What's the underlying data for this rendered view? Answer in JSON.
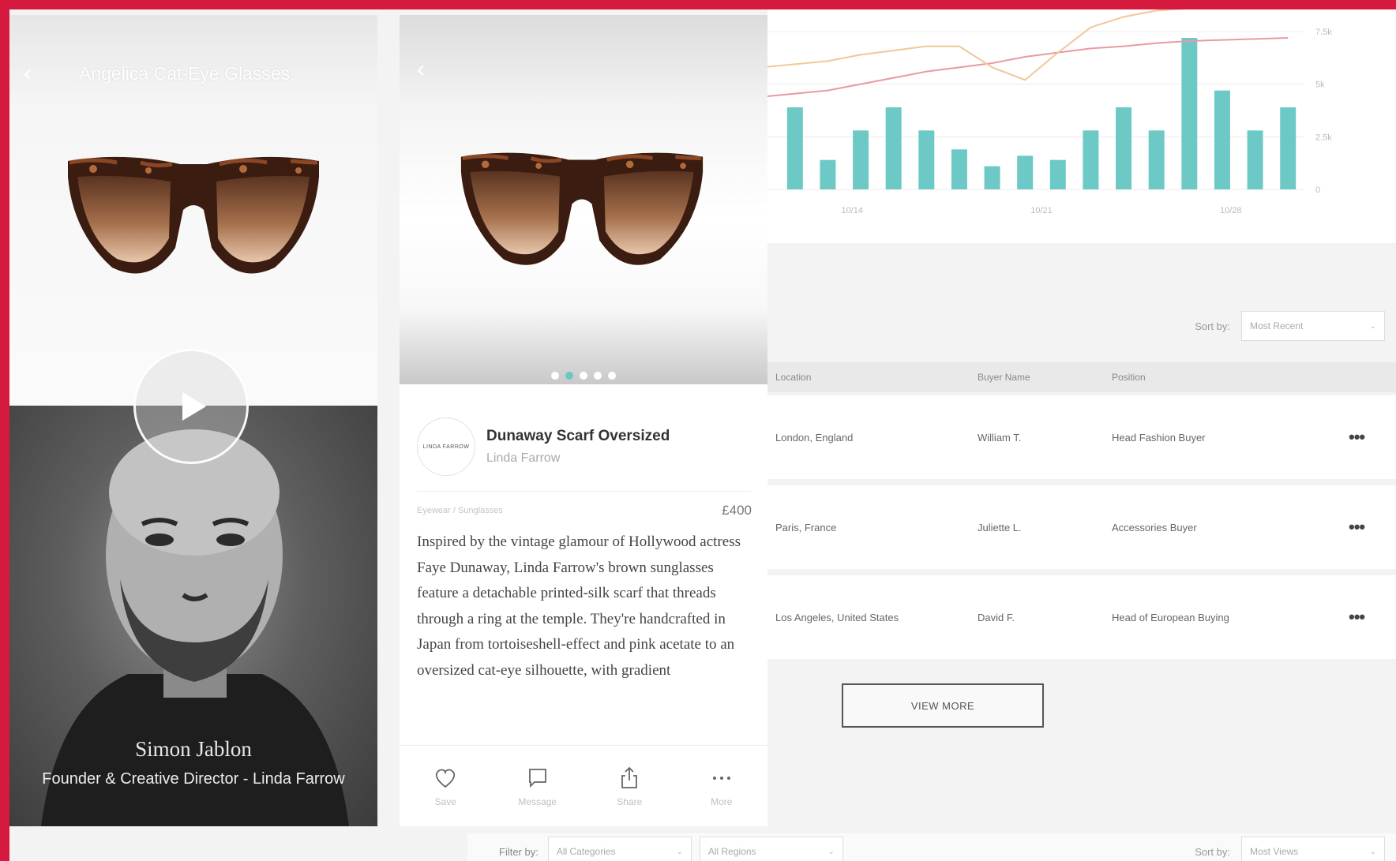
{
  "left_panel": {
    "back_icon": "chevron-left-icon",
    "title": "Angelica Cat-Eye Glasses",
    "person_name": "Simon Jablon",
    "person_role": "Founder & Creative Director - Linda Farrow",
    "play_icon": "play-icon"
  },
  "product": {
    "back_icon": "chevron-left-icon",
    "brand_logo_text": "LINDA FARROW",
    "name": "Dunaway Scarf Oversized",
    "brand": "Linda Farrow",
    "breadcrumb": "Eyewear / Sunglasses",
    "price": "£400",
    "carousel_dots": 5,
    "carousel_active": 1,
    "description": "Inspired by the vintage glamour of Hollywood actress Faye Dunaway, Linda Farrow's brown sunglasses feature a detachable printed-silk scarf that threads through a ring at the temple. They're handcrafted in Japan from tortoiseshell-effect and pink acetate to an oversized cat-eye silhouette, with gradient",
    "actions": [
      {
        "label": "Save",
        "icon": "heart-icon"
      },
      {
        "label": "Message",
        "icon": "message-icon"
      },
      {
        "label": "Share",
        "icon": "share-icon"
      },
      {
        "label": "More",
        "icon": "more-icon"
      }
    ]
  },
  "chart_data": {
    "type": "bar",
    "y_ticks": [
      "0",
      "2.5k",
      "5k",
      "7.5k"
    ],
    "x_ticks": [
      "10/14",
      "10/21",
      "10/28"
    ],
    "ylim": [
      0,
      7500
    ],
    "values": [
      3900,
      1400,
      2800,
      3900,
      2800,
      1900,
      1100,
      1600,
      1400,
      2800,
      3900,
      2800,
      7200,
      4700,
      2800,
      3900
    ],
    "lines": [
      {
        "color": "#e89aa3",
        "values": [
          4400,
          4700,
          5000,
          5300,
          5600,
          5800,
          6000,
          6300,
          6500,
          6700,
          6800,
          6950,
          7050,
          7100,
          7150,
          7200
        ]
      },
      {
        "color": "#f0c89a",
        "values": [
          5800,
          6100,
          6400,
          6600,
          6800,
          6800,
          5800,
          5200,
          6500,
          7700,
          8200,
          8500,
          8600,
          8700,
          8800,
          8900
        ]
      }
    ],
    "bar_color": "#6cc9c5",
    "grid": true
  },
  "buyers": {
    "sort_label": "Sort by:",
    "sort_value": "Most Recent",
    "columns": [
      "Location",
      "Buyer Name",
      "Position"
    ],
    "rows": [
      {
        "location": "London, England",
        "name": "William T.",
        "position": "Head Fashion Buyer"
      },
      {
        "location": "Paris, France",
        "name": "Juliette L.",
        "position": "Accessories Buyer"
      },
      {
        "location": "Los Angeles, United States",
        "name": "David F.",
        "position": "Head of European Buying"
      }
    ],
    "more_icon": "ellipsis-icon",
    "more_glyph": "•••",
    "view_more": "VIEW MORE"
  },
  "filters": {
    "filter_label": "Filter by:",
    "category": "All Categories",
    "region": "All Regions",
    "sort_label": "Sort by:",
    "sort_value": "Most Views",
    "chevron_icon": "chevron-down-icon",
    "chevron_glyph": "⌄"
  }
}
